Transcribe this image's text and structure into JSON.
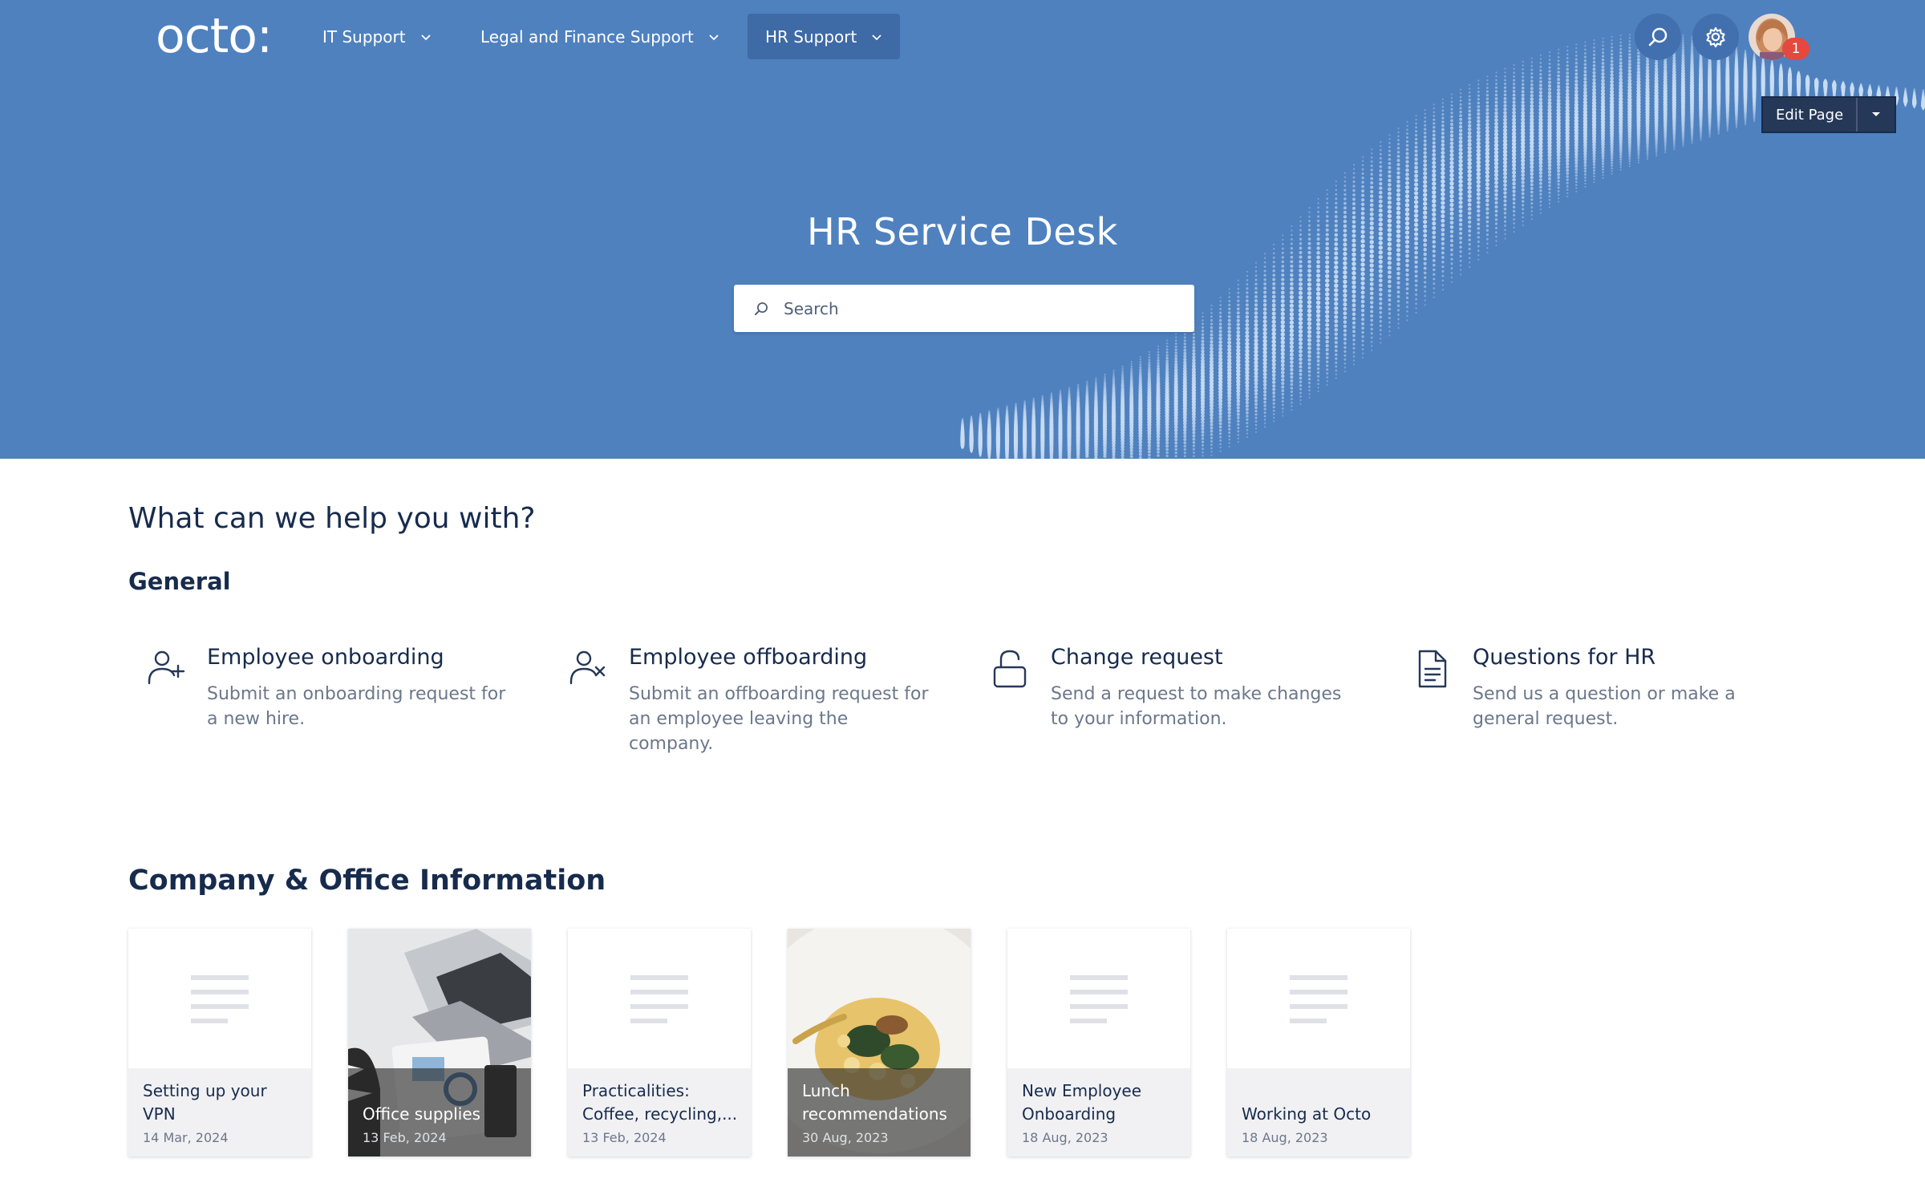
{
  "nav": {
    "logo": "octo:",
    "items": [
      {
        "label": "IT Support"
      },
      {
        "label": "Legal and Finance Support"
      },
      {
        "label": "HR Support"
      }
    ],
    "notification_count": "1",
    "edit_label": "Edit Page"
  },
  "hero": {
    "title": "HR Service Desk",
    "search_placeholder": "Search"
  },
  "help": {
    "heading": "What can we help you with?",
    "group": "General",
    "requests": [
      {
        "title": "Employee onboarding",
        "desc": "Submit an onboarding request for a new hire.",
        "icon": "person-add-icon"
      },
      {
        "title": "Employee offboarding",
        "desc": "Submit an offboarding request for an employee leaving the company.",
        "icon": "person-remove-icon"
      },
      {
        "title": "Change request",
        "desc": "Send a request to make changes to your information.",
        "icon": "unlock-icon"
      },
      {
        "title": "Questions for HR",
        "desc": "Send us a question or make a general request.",
        "icon": "document-icon"
      }
    ]
  },
  "company": {
    "heading": "Company & Office Information",
    "articles": [
      {
        "title": "Setting up your VPN",
        "date": "14 Mar, 2024"
      },
      {
        "title": "Office supplies",
        "date": "13 Feb, 2024"
      },
      {
        "title": "Practicalities: Coffee, recycling,...",
        "date": "13 Feb, 2024"
      },
      {
        "title": "Lunch recommendations",
        "date": "30 Aug, 2023"
      },
      {
        "title": "New Employee Onboarding",
        "date": "18 Aug, 2023"
      },
      {
        "title": "Working at Octo",
        "date": "18 Aug, 2023"
      }
    ]
  },
  "colors": {
    "hero_bg": "#4f81bf",
    "nav_active": "#3e6aa5",
    "text": "#172b4d",
    "muted": "#6b778c",
    "badge": "#e5483e"
  }
}
